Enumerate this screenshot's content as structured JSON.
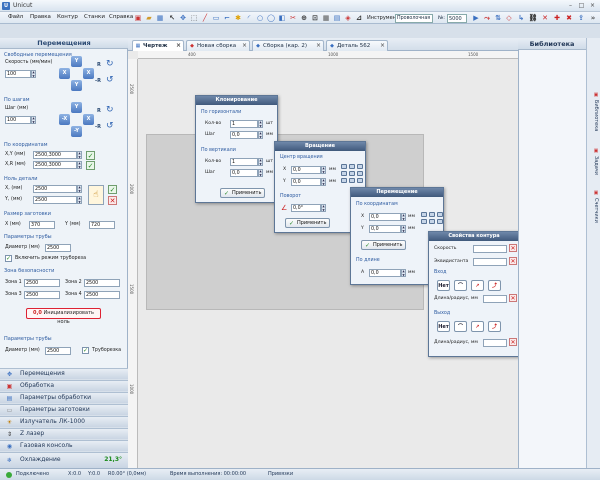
{
  "window": {
    "title": "Unicut",
    "minimize": "–",
    "maximize": "□",
    "close": "×"
  },
  "menu": [
    "Файл",
    "Правка",
    "Контур",
    "Станки",
    "Справка"
  ],
  "toolbar": {
    "instrument_label": "Инструмент:",
    "instrument_value": "Проволочная",
    "number_label": "№:",
    "number_value": "5000"
  },
  "tabs": [
    {
      "label": "Чертеж",
      "icon": "drawing-icon",
      "close": "×"
    },
    {
      "label": "Новая сборка",
      "icon": "assembly-icon",
      "close": "×"
    },
    {
      "label": "Сборка (кар. 2)",
      "icon": "assembly-icon",
      "close": "×"
    },
    {
      "label": "Деталь 562",
      "icon": "part-icon",
      "close": "×"
    }
  ],
  "left_panel": {
    "title": "Перемещения",
    "free_move": {
      "section": "Свободные перемещения",
      "speed_label": "Скорость (мм/мин)",
      "speed_value": "100",
      "btn_up": "Y",
      "btn_left": "X",
      "btn_right": "X",
      "btn_down": "Y",
      "rot_r": "R",
      "rot_minus_r": "-R"
    },
    "by_step": {
      "section": "По шагам",
      "step_label": "Шаг (мм)",
      "step_value": "100",
      "btn_up": "Y",
      "btn_left": "-X",
      "btn_right": "X",
      "btn_down": "-Y",
      "rot_r": "R",
      "rot_minus_r": "-R"
    },
    "by_coords": {
      "section": "По координатам",
      "xy_label": "X,Y (мм)",
      "xy_value": "2500,3000",
      "xr_label": "X,R (мм)",
      "xr_value": "2500,3000"
    },
    "part_zero": {
      "section": "Ноль детали",
      "x_label": "X, (мм)",
      "x_value": "2500",
      "y_label": "Y, (мм)",
      "y_value": "2500"
    },
    "blank_size": {
      "section": "Размер заготовки",
      "x_label": "X (мм)",
      "x_value": "370",
      "y_label": "Y (мм)",
      "y_value": "720"
    },
    "tube_params": {
      "section": "Параметры трубы",
      "diameter_label": "Диаметр (мм)",
      "diameter_value": "2500",
      "enable_label": "Включить режим трубореза"
    },
    "safety_zone": {
      "section": "Зона безопасности",
      "zone1_label": "Зона 1",
      "zone1_value": "2500",
      "zone2_label": "Зона 2",
      "zone2_value": "2500",
      "zone3_label": "Зона 3",
      "zone3_value": "2500",
      "zone4_label": "Зона 4",
      "zone4_value": "2500"
    },
    "init_button": "Инициализировать ноль",
    "init_prefix": "0,0",
    "tube_params2": {
      "section": "Параметры трубы",
      "diameter_label": "Диаметр (мм)",
      "diameter_value": "2500",
      "tube_cutter_label": "Труборезка"
    }
  },
  "accordion": [
    {
      "label": "Перемещения",
      "icon": "move-icon"
    },
    {
      "label": "Обработка",
      "icon": "process-icon"
    },
    {
      "label": "Параметры обработки",
      "icon": "settings-icon"
    },
    {
      "label": "Параметры заготовки",
      "icon": "blank-icon"
    },
    {
      "label": "Излучатель ЛК-1000",
      "icon": "laser-icon"
    },
    {
      "label": "Z лазер",
      "icon": "z-laser-icon"
    },
    {
      "label": "Газовая консоль",
      "icon": "gas-icon"
    },
    {
      "label": "Охлаждение",
      "icon": "cooling-icon"
    }
  ],
  "cooling_temp": "21,3°",
  "ruler": {
    "top": [
      "400",
      "1000",
      "1500"
    ],
    "left": [
      "2500",
      "2000",
      "1500",
      "1000"
    ]
  },
  "library": {
    "title": "Библиотека",
    "vtabs": [
      {
        "label": "Библиотека",
        "icon": "library-icon"
      },
      {
        "label": "Задачи",
        "icon": "tasks-icon"
      },
      {
        "label": "Счетчики",
        "icon": "counters-icon"
      }
    ]
  },
  "dlg_clone": {
    "title": "Клонирование",
    "horiz_section": "По горизонтали",
    "count_label": "Кол-во",
    "count_value": "1",
    "count_unit": "шт",
    "step_label": "Шаг",
    "step_value": "0,0",
    "step_unit": "мм",
    "vert_section": "По вертикали",
    "v_count_label": "Кол-во",
    "v_count_value": "1",
    "v_count_unit": "шт",
    "v_step_label": "Шаг",
    "v_step_value": "0,0",
    "v_step_unit": "мм",
    "apply": "Применить"
  },
  "dlg_rotate": {
    "title": "Вращение",
    "center_section": "Центр вращения",
    "x_label": "X",
    "x_value": "0,0",
    "x_unit": "мм",
    "y_label": "Y",
    "y_value": "0,0",
    "y_unit": "мм",
    "angle_section": "Поворот",
    "angle_value": "0,0°",
    "apply": "Применить"
  },
  "dlg_move": {
    "title": "Перемещение",
    "coords_section": "По координатам",
    "x_label": "X",
    "x_value": "0,0",
    "x_unit": "мм",
    "y_label": "Y",
    "y_value": "0,0",
    "y_unit": "мм",
    "apply": "Применить",
    "axis_section": "По длине",
    "a_label": "A",
    "a_value": "0,0",
    "a_unit": "мм"
  },
  "dlg_contour": {
    "title": "Свойства контура",
    "speed_label": "Скорость",
    "eq_label": "Эквидистанта",
    "in_section": "Вход",
    "in_len_label": "Длина/радиус, мм",
    "out_section": "Выход",
    "out_len_label": "Длина/радиус, мм",
    "tool_none": "Нет"
  },
  "status": {
    "connected": "Подключено",
    "x": "X:0.0",
    "y": "Y:0.0",
    "r": "R0.00° (0,0мм)",
    "time": "Время выполнения: 00:00:00",
    "snap": "Привязки"
  },
  "colors": {
    "accent": "#2c5aa0",
    "ok": "#2a8a2a",
    "danger": "#cc2222",
    "dialog_title": "#4a6384"
  }
}
